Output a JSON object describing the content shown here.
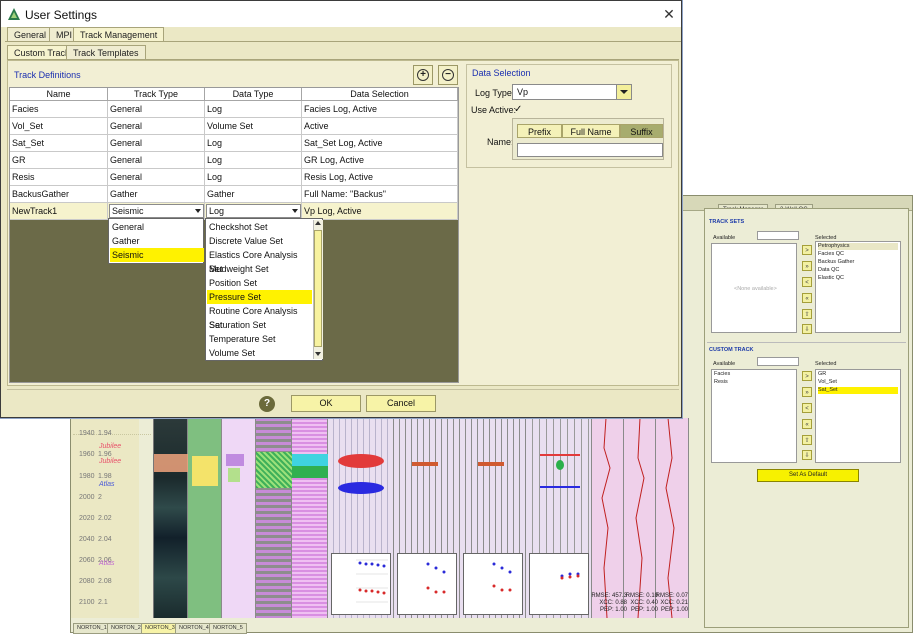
{
  "dialog": {
    "title": "User Settings",
    "close": "✕",
    "tabs": [
      "General",
      "MPI",
      "Track Management"
    ],
    "subtabs": [
      "Custom Tracks",
      "Track Templates"
    ],
    "track_definitions_title": "Track Definitions",
    "add_glyph": "+",
    "remove_glyph": "−",
    "columns": [
      "Name",
      "Track Type",
      "Data Type",
      "Data Selection"
    ],
    "rows": [
      [
        "Facies",
        "General",
        "Log",
        "Facies Log, Active"
      ],
      [
        "Vol_Set",
        "General",
        "Volume Set",
        "Active"
      ],
      [
        "Sat_Set",
        "General",
        "Log",
        "Sat_Set Log, Active"
      ],
      [
        "GR",
        "General",
        "Log",
        "GR Log, Active"
      ],
      [
        "Resis",
        "General",
        "Log",
        "Resis Log, Active"
      ],
      [
        "BackusGather",
        "Gather",
        "Gather",
        "Full Name: \"Backus\""
      ]
    ],
    "new_row": [
      "NewTrack1",
      "Seismic",
      "Log",
      "Vp Log, Active"
    ],
    "track_type_options": [
      "General",
      "Gather",
      "Seismic"
    ],
    "track_type_selected": "Seismic",
    "data_type_options": [
      "Checkshot Set",
      "Discrete Value Set",
      "Elastics Core Analysis Set",
      "Mudweight Set",
      "Position Set",
      "Pressure Set",
      "Routine Core Analysis Set",
      "Saturation Set",
      "Temperature Set",
      "Volume Set"
    ],
    "data_type_selected": "Pressure Set",
    "data_selection": {
      "title": "Data Selection",
      "log_type_label": "Log Type:",
      "log_type_value": "Vp",
      "use_active_label": "Use Active:",
      "use_active_check": "✓",
      "name_label": "Name:",
      "name_modes": [
        "Prefix",
        "Full Name",
        "Suffix"
      ],
      "name_mode_selected": "Suffix",
      "name_value": ""
    },
    "help": "?",
    "ok": "OK",
    "cancel": "Cancel"
  },
  "track_manager": {
    "tabs": [
      "Track Manager",
      "2-Well QC"
    ],
    "track_sets": {
      "header": "TRACK SETS",
      "available_label": "Available",
      "selected_label": "Selected",
      "empty_text": "<None available>",
      "selected": [
        "Petrophysics",
        "Facies QC",
        "Backus Gather",
        "Data QC",
        "Elastic QC"
      ]
    },
    "custom_track": {
      "header": "CUSTOM TRACK",
      "available_label": "Available",
      "selected_label": "Selected",
      "available": [
        "Facies",
        "Resis"
      ],
      "selected": [
        "GR",
        "Vol_Set",
        "Sat_Set"
      ],
      "selected_highlight": "Sat_Set"
    },
    "buttons": [
      ">",
      "»",
      "<",
      "«",
      "⇧",
      "⇩"
    ],
    "set_default": "Set As Default"
  },
  "log_view": {
    "depths_ft": [
      "1940",
      "1960",
      "1980",
      "2000",
      "2020",
      "2040",
      "2060",
      "2080",
      "2100"
    ],
    "depths_m": [
      "1.94",
      "1.96",
      "1.98",
      "2",
      "2.02",
      "2.04",
      "2.06",
      "2.08",
      "2.1"
    ],
    "markers": [
      {
        "label": "Jubilee",
        "color": "#e8506a"
      },
      {
        "label": "Jubilee",
        "color": "#e8506a"
      },
      {
        "label": "Atlas",
        "color": "#4a5ad8"
      },
      {
        "label": "Atlas",
        "color": "#c06ad0"
      }
    ],
    "plot_ticks": [
      "7500",
      "5000",
      "2500",
      "0",
      "-2500",
      "-5000",
      "-7500",
      "-10000"
    ],
    "stats": [
      {
        "rmse": "RMSE: 457.3",
        "xcc": "XCC: 0.88",
        "pep": "PEP: 1.00"
      },
      {
        "rmse": "RMSE: 0.10",
        "xcc": "XCC: 0.40",
        "pep": "PEP: 1.00"
      },
      {
        "rmse": "RMSE: 0.07",
        "xcc": "XCC: 0.21",
        "pep": "PEP: 1.00"
      }
    ],
    "well_tabs": [
      "NORTON_1",
      "NORTON_2",
      "NORTON_3",
      "NORTON_4",
      "NORTON_5"
    ]
  }
}
